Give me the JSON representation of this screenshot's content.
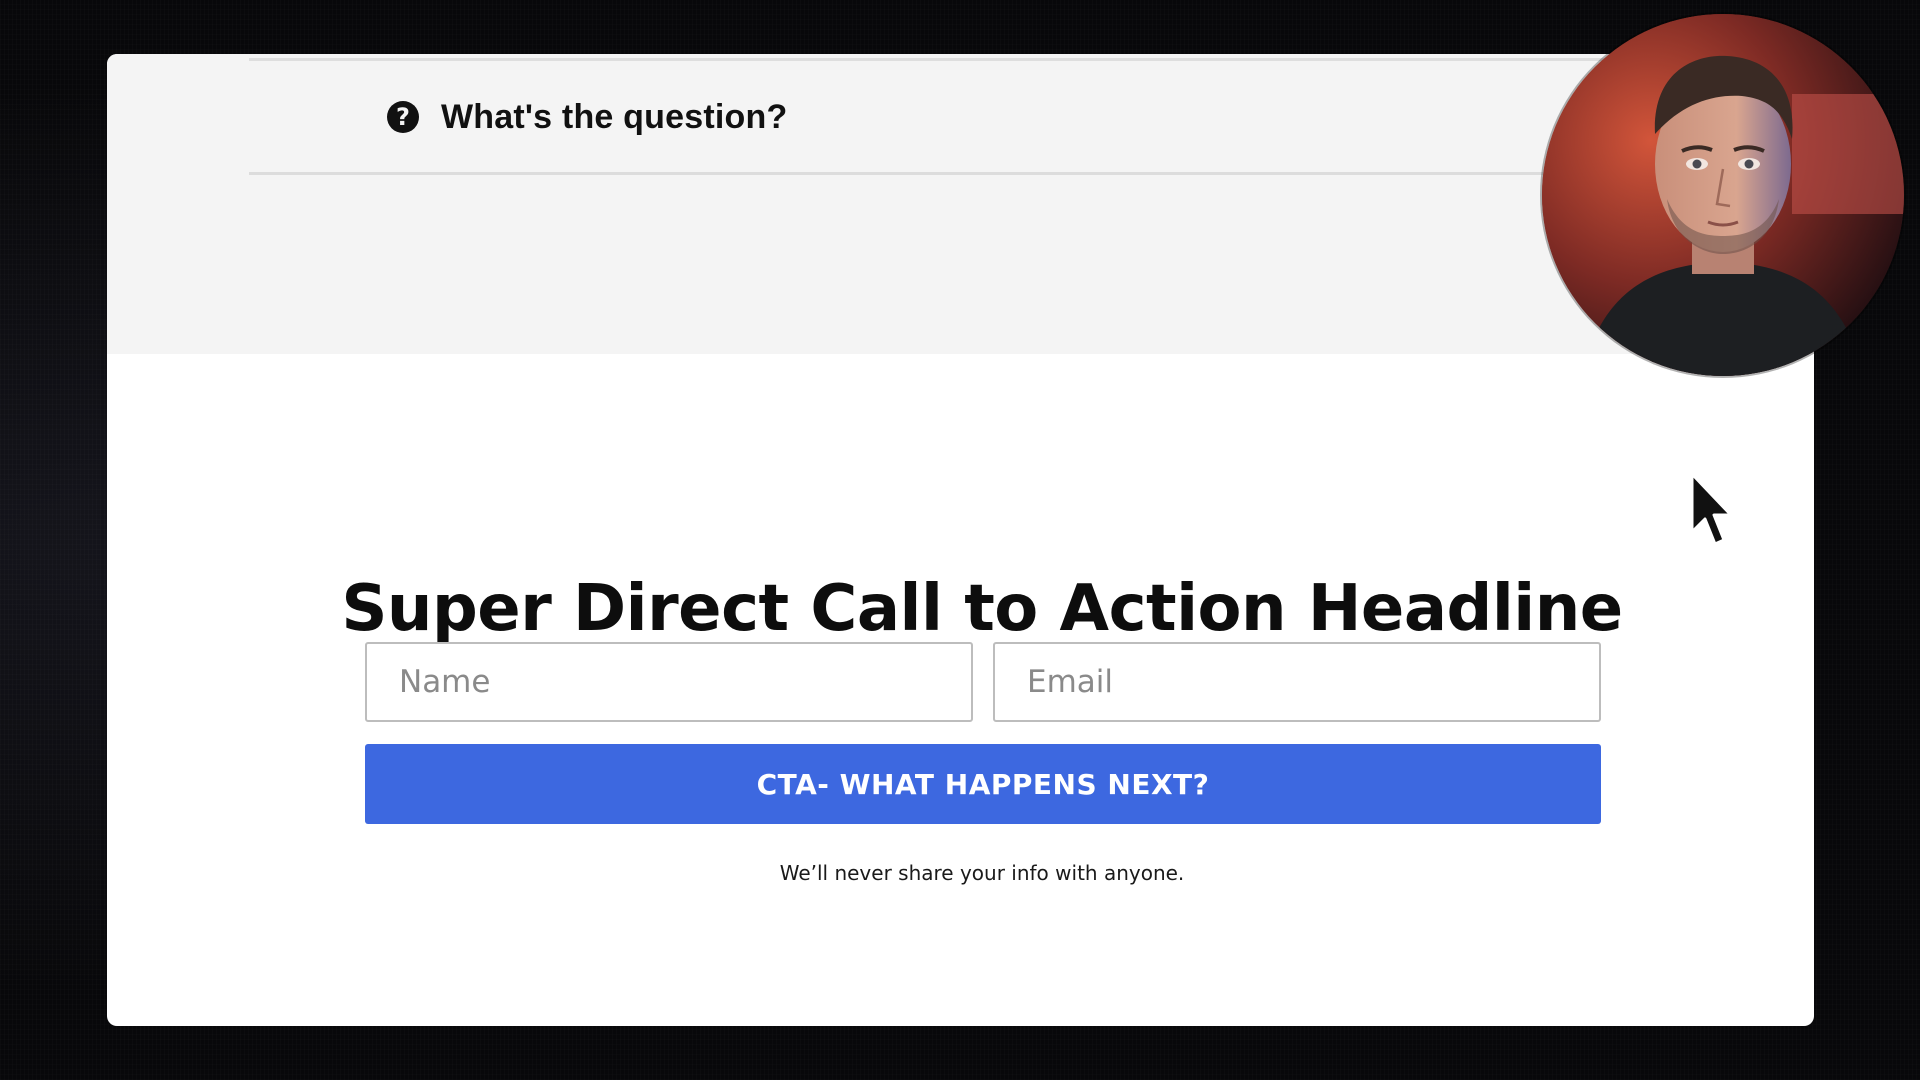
{
  "faq": {
    "question": "What's the question?",
    "icon": "question-circle-icon"
  },
  "cta": {
    "headline": "Super Direct Call to Action Headline",
    "name_placeholder": "Name",
    "email_placeholder": "Email",
    "button_label": "CTA- WHAT HAPPENS NEXT?",
    "privacy_note": "We’ll never share your info with anyone."
  },
  "overlay": {
    "webcam": "presenter-webcam",
    "cursor_icon": "mouse-pointer-icon"
  },
  "colors": {
    "button": "#3d68e0",
    "faq_background": "#f4f4f4",
    "page_background": "#ffffff",
    "backdrop": "#08080a"
  }
}
